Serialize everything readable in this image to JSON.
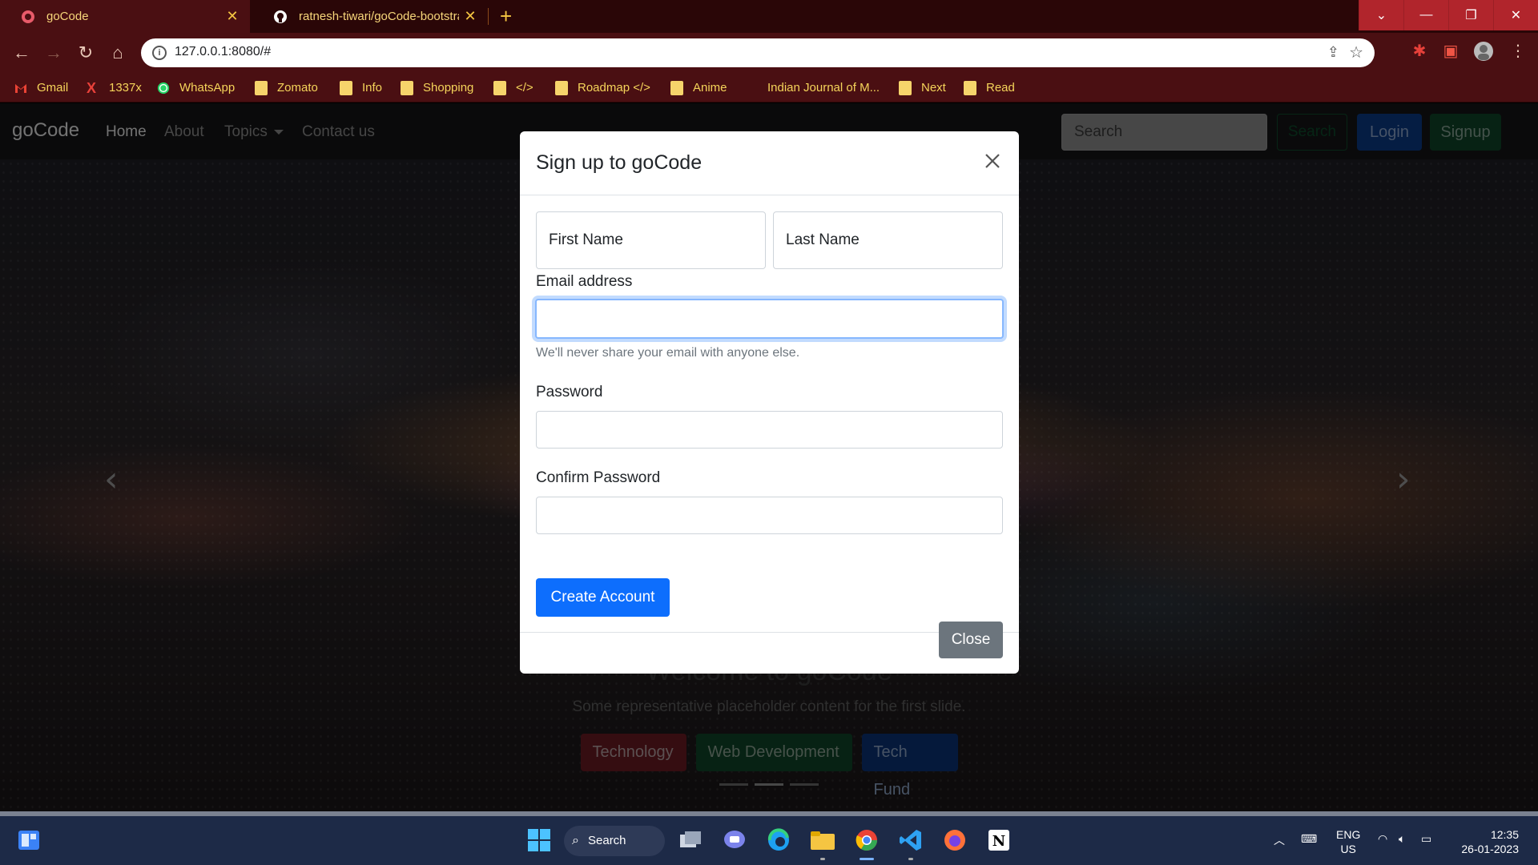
{
  "browser": {
    "tabs": [
      {
        "title": "goCode",
        "active": true
      },
      {
        "title": "ratnesh-tiwari/goCode-bootstrap",
        "active": false
      }
    ],
    "new_tab": "+",
    "url": "127.0.0.1:8080/#",
    "bookmarks": [
      {
        "label": "Gmail",
        "icon": "gmail-icon"
      },
      {
        "label": "1337x",
        "icon": "x-icon"
      },
      {
        "label": "WhatsApp",
        "icon": "whatsapp-icon"
      },
      {
        "label": "Zomato",
        "icon": "folder-icon"
      },
      {
        "label": "Info",
        "icon": "folder-icon"
      },
      {
        "label": "Shopping",
        "icon": "folder-icon"
      },
      {
        "label": "</>",
        "icon": "folder-icon"
      },
      {
        "label": "Roadmap </>",
        "icon": "folder-icon"
      },
      {
        "label": "Anime",
        "icon": "folder-icon"
      },
      {
        "label": "Indian Journal of M...",
        "icon": "page-icon"
      },
      {
        "label": "Next",
        "icon": "folder-icon"
      },
      {
        "label": "Read",
        "icon": "folder-icon"
      }
    ]
  },
  "navbar": {
    "brand": "goCode",
    "links": [
      "Home",
      "About",
      "Topics",
      "Contact us"
    ],
    "search_placeholder": "Search",
    "search_button": "Search",
    "login": "Login",
    "signup": "Signup"
  },
  "carousel": {
    "heading": "Welcome to goCode",
    "caption": "Some representative placeholder content for the first slide.",
    "buttons": [
      "Technology",
      "Web Development",
      "Tech Fund"
    ]
  },
  "modal": {
    "title": "Sign up to goCode",
    "first_name_placeholder": "First Name",
    "last_name_placeholder": "Last Name",
    "email_label": "Email address",
    "email_value": "",
    "email_help": "We'll never share your email with anyone else.",
    "password_label": "Password",
    "confirm_label": "Confirm Password",
    "submit": "Create Account",
    "close": "Close"
  },
  "taskbar": {
    "search": "Search",
    "lang_top": "ENG",
    "lang_bottom": "US",
    "time": "12:35",
    "date": "26-01-2023"
  },
  "colors": {
    "browser_frame": "#4a0f12",
    "primary": "#0d6efd",
    "secondary": "#6c757d"
  }
}
